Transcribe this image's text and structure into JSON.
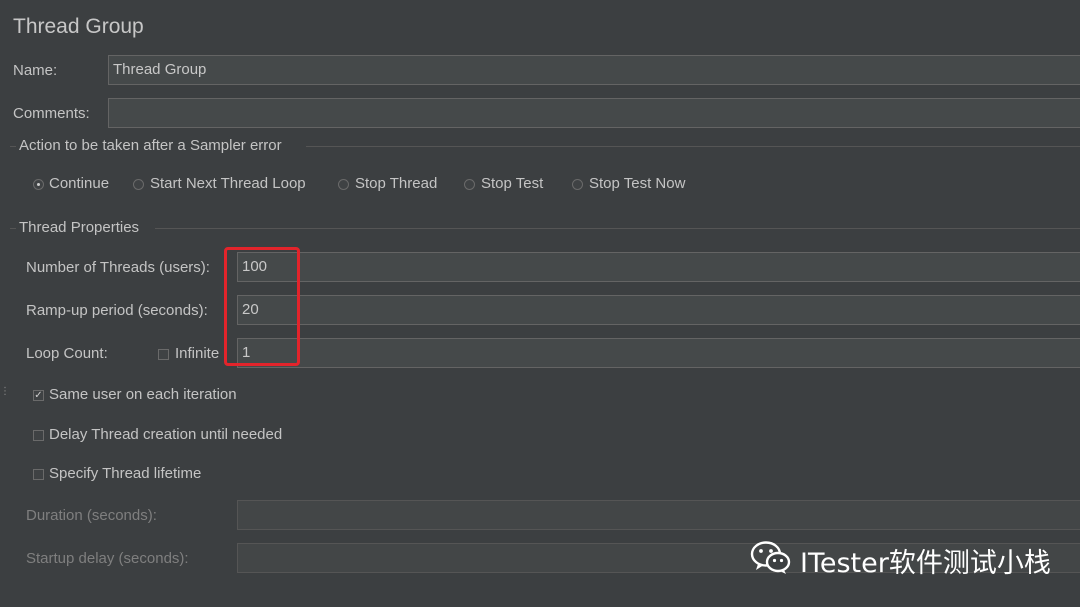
{
  "panel": {
    "title": "Thread Group"
  },
  "name": {
    "label": "Name:",
    "value": "Thread Group"
  },
  "comments": {
    "label": "Comments:",
    "value": ""
  },
  "sampler_error": {
    "legend": "Action to be taken after a Sampler error",
    "options": [
      "Continue",
      "Start Next Thread Loop",
      "Stop Thread",
      "Stop Test",
      "Stop Test Now"
    ],
    "selected": "Continue"
  },
  "thread_properties": {
    "legend": "Thread Properties",
    "threads_label": "Number of Threads (users):",
    "threads_value": "100",
    "rampup_label": "Ramp-up period (seconds):",
    "rampup_value": "20",
    "loop_label": "Loop Count:",
    "infinite_label": "Infinite",
    "infinite_checked": false,
    "loop_value": "1"
  },
  "checkboxes": {
    "same_user": {
      "label": "Same user on each iteration",
      "checked": true
    },
    "delay_creation": {
      "label": "Delay Thread creation until needed",
      "checked": false
    },
    "lifetime": {
      "label": "Specify Thread lifetime",
      "checked": false
    }
  },
  "lifetime_fields": {
    "duration_label": "Duration (seconds):",
    "duration_value": "",
    "startup_label": "Startup delay (seconds):",
    "startup_value": ""
  },
  "watermark": {
    "text": "ITester软件测试小栈",
    "icon": "wechat-icon"
  },
  "colors": {
    "background": "#3c3f41",
    "highlight": "#e3242b"
  }
}
